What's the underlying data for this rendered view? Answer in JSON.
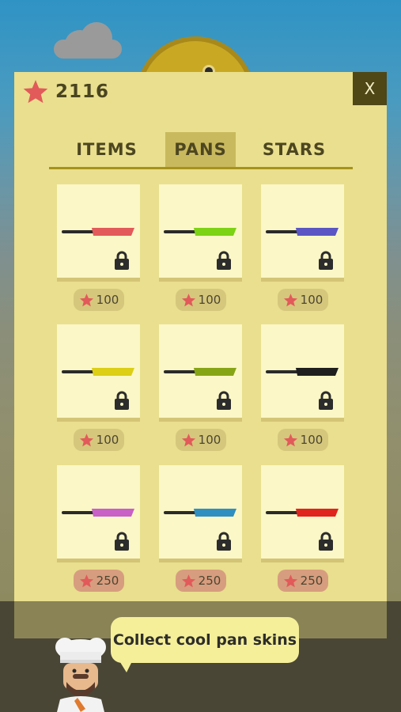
{
  "score": "2116",
  "close_label": "X",
  "tabs": [
    {
      "label": "ITEMS",
      "active": false
    },
    {
      "label": "PANS",
      "active": true
    },
    {
      "label": "STARS",
      "active": false
    }
  ],
  "pans": [
    {
      "color": "#e25a5a",
      "price": "100",
      "locked": true
    },
    {
      "color": "#7cd214",
      "price": "100",
      "locked": true
    },
    {
      "color": "#5b56c4",
      "price": "100",
      "locked": true
    },
    {
      "color": "#dccf16",
      "price": "100",
      "locked": true
    },
    {
      "color": "#86a516",
      "price": "100",
      "locked": true
    },
    {
      "color": "#1f1f1f",
      "price": "100",
      "locked": true
    },
    {
      "color": "#c860c8",
      "price": "250",
      "locked": true
    },
    {
      "color": "#2f8fc0",
      "price": "250",
      "locked": true
    },
    {
      "color": "#e0251e",
      "price": "250",
      "locked": true
    }
  ],
  "tip": "Collect cool pan skins",
  "colors": {
    "panel": "#e9df8e",
    "card": "#fbf7c6",
    "accent": "#a6921c",
    "star": "#e25a5a",
    "handle": "#2a2a2a"
  },
  "icons": {
    "star": "star-icon",
    "lock": "lock-icon",
    "close": "close-icon"
  }
}
